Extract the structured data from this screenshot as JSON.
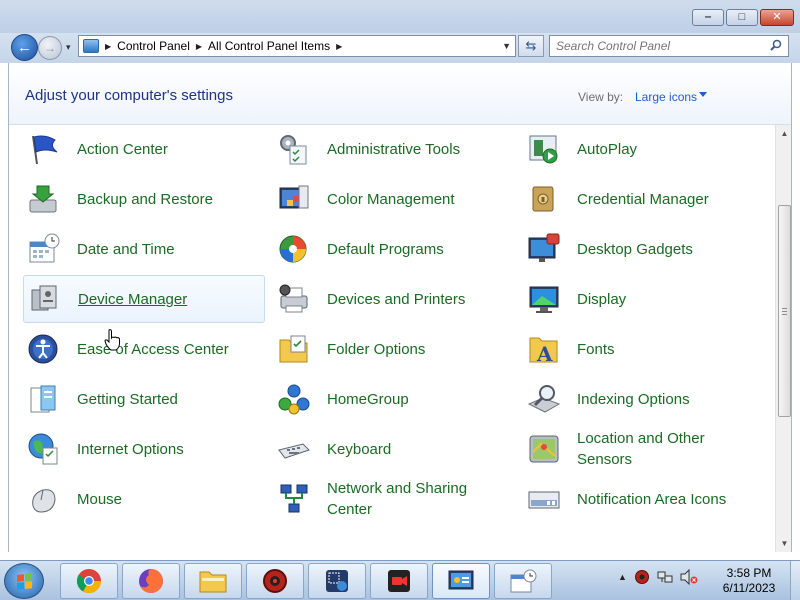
{
  "window": {
    "minimize_glyph": "‒",
    "maximize_glyph": "□",
    "close_glyph": "✕"
  },
  "navbar": {
    "breadcrumbs": [
      "Control Panel",
      "All Control Panel Items"
    ],
    "search": {
      "placeholder": "Search Control Panel"
    }
  },
  "header": {
    "title": "Adjust your computer's settings",
    "view_by_label": "View by:",
    "view_by_value": "Large icons"
  },
  "items": [
    [
      "Action Center",
      "Administrative Tools",
      "AutoPlay"
    ],
    [
      "Backup and Restore",
      "Color Management",
      "Credential Manager"
    ],
    [
      "Date and Time",
      "Default Programs",
      "Desktop Gadgets"
    ],
    [
      "Device Manager",
      "Devices and Printers",
      "Display"
    ],
    [
      "Ease of Access Center",
      "Folder Options",
      "Fonts"
    ],
    [
      "Getting Started",
      "HomeGroup",
      "Indexing Options"
    ],
    [
      "Internet Options",
      "Keyboard",
      "Location and Other Sensors"
    ],
    [
      "Mouse",
      "Network and Sharing Center",
      "Notification Area Icons"
    ]
  ],
  "hovered_item": "Device Manager",
  "taskbar": {
    "apps": [
      "chrome",
      "firefox",
      "file-explorer",
      "red-gear-app",
      "screenshot-tool",
      "screen-recorder",
      "control-panel",
      "date-time-settings"
    ],
    "active_app": "control-panel",
    "tray_arrow": "▲",
    "time": "3:58 PM",
    "date": "6/11/2023"
  },
  "colors": {
    "link_green": "#1b6b24",
    "title_blue": "#1e3287",
    "accent_blue": "#1e5ecc"
  }
}
